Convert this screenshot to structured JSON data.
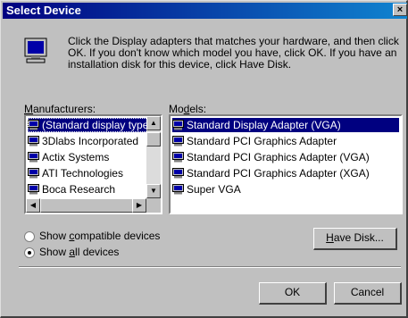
{
  "window": {
    "title": "Select Device",
    "close_glyph": "×"
  },
  "intro": {
    "icon": "monitor-icon",
    "text": "Click the Display adapters that matches your hardware, and then click OK. If you don't know which model you have, click OK. If you have an installation disk for this device, click Have Disk."
  },
  "manufacturers": {
    "label_pre": "",
    "label_accel": "M",
    "label_post": "anufacturers:",
    "items": [
      "(Standard display types)",
      "3Dlabs Incorporated",
      "Actix Systems",
      "ATI Technologies",
      "Boca Research"
    ],
    "selected_index": 0
  },
  "models": {
    "label_pre": "Mo",
    "label_accel": "d",
    "label_post": "els:",
    "items": [
      "Standard Display Adapter (VGA)",
      "Standard PCI Graphics Adapter",
      "Standard PCI Graphics Adapter (VGA)",
      "Standard PCI Graphics Adapter (XGA)",
      "Super VGA"
    ],
    "selected_index": 0
  },
  "options": {
    "compatible": {
      "pre": "Show ",
      "accel": "c",
      "post": "ompatible devices",
      "checked": false
    },
    "all": {
      "pre": "Show ",
      "accel": "a",
      "post": "ll devices",
      "checked": true
    }
  },
  "buttons": {
    "have_disk": {
      "accel": "H",
      "post": "ave Disk..."
    },
    "ok": "OK",
    "cancel": "Cancel"
  },
  "colors": {
    "selection": "#000080",
    "face": "#c0c0c0",
    "title_start": "#000080"
  }
}
